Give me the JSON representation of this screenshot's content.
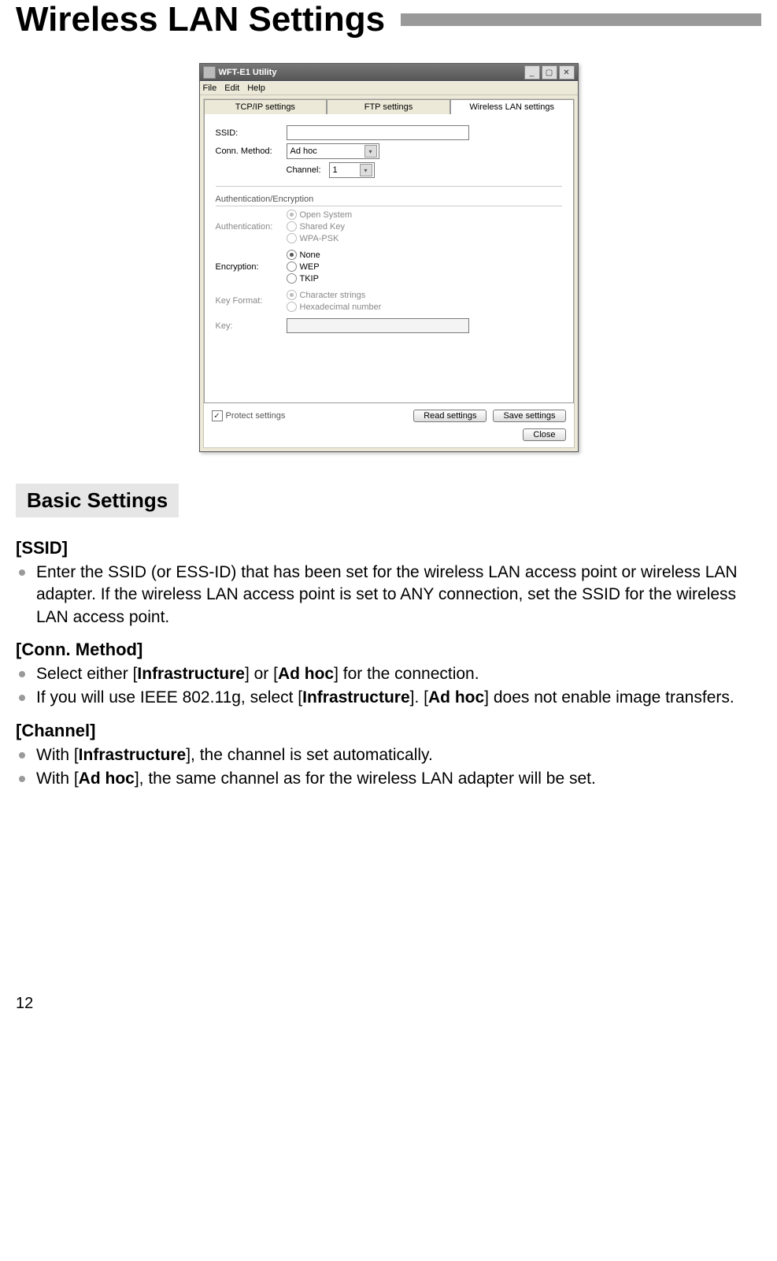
{
  "page": {
    "title": "Wireless LAN Settings",
    "section_heading": "Basic Settings",
    "page_number": "12"
  },
  "screenshot": {
    "window_title": "WFT-E1 Utility",
    "menus": {
      "file": "File",
      "edit": "Edit",
      "help": "Help"
    },
    "tabs": {
      "tcpip": "TCP/IP settings",
      "ftp": "FTP settings",
      "wlan": "Wireless LAN settings"
    },
    "fields": {
      "ssid_label": "SSID:",
      "conn_label": "Conn. Method:",
      "conn_value": "Ad hoc",
      "channel_label": "Channel:",
      "channel_value": "1",
      "group_label": "Authentication/Encryption",
      "auth_label": "Authentication:",
      "auth_opts": {
        "open": "Open System",
        "shared": "Shared Key",
        "wpa": "WPA-PSK"
      },
      "enc_label": "Encryption:",
      "enc_opts": {
        "none": "None",
        "wep": "WEP",
        "tkip": "TKIP"
      },
      "keyfmt_label": "Key Format:",
      "keyfmt_opts": {
        "char": "Character strings",
        "hex": "Hexadecimal number"
      },
      "key_label": "Key:"
    },
    "bottom": {
      "protect": "Protect settings",
      "read": "Read settings",
      "save": "Save settings",
      "close": "Close"
    }
  },
  "doc": {
    "ssid_head": "[SSID]",
    "ssid_bullet1": "Enter the SSID (or ESS-ID) that has been set for the wireless LAN access point or wireless LAN adapter. If the wireless LAN access point is set to ANY connection, set the SSID for the wireless LAN access point.",
    "conn_head": "[Conn. Method]",
    "conn_bullet1_a": "Select either [",
    "conn_bullet1_b": "Infrastructure",
    "conn_bullet1_c": "] or [",
    "conn_bullet1_d": "Ad hoc",
    "conn_bullet1_e": "] for the connection.",
    "conn_bullet2_a": "If you will use IEEE 802.11g, select [",
    "conn_bullet2_b": "Infrastructure",
    "conn_bullet2_c": "]. [",
    "conn_bullet2_d": "Ad hoc",
    "conn_bullet2_e": "] does not enable image transfers.",
    "chan_head": "[Channel]",
    "chan_bullet1_a": "With [",
    "chan_bullet1_b": "Infrastructure",
    "chan_bullet1_c": "], the channel is set automatically.",
    "chan_bullet2_a": "With [",
    "chan_bullet2_b": "Ad hoc",
    "chan_bullet2_c": "], the same channel as for the wireless LAN adapter will be set."
  }
}
